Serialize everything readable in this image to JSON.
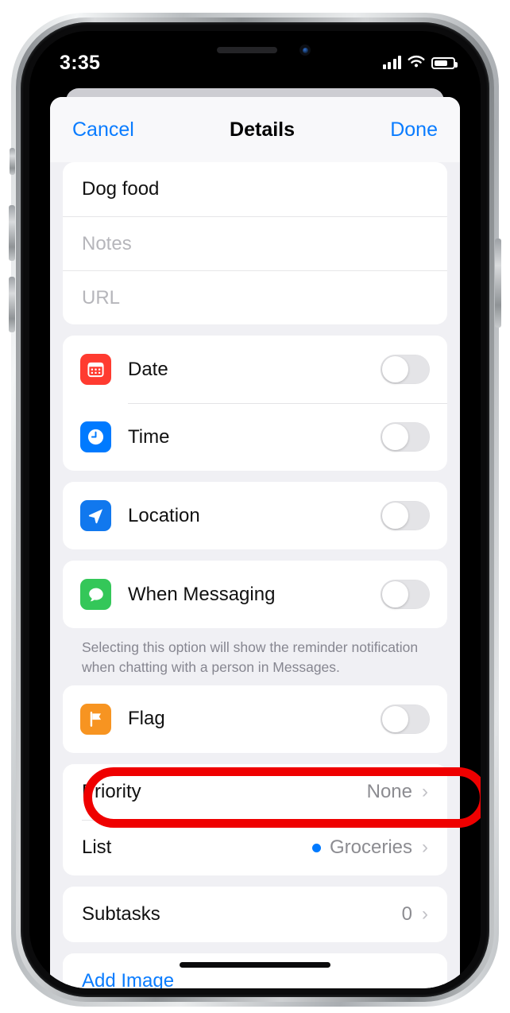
{
  "status_bar": {
    "time": "3:35",
    "signal_icon": "cellular-bars-icon",
    "wifi_icon": "wifi-icon",
    "battery_icon": "battery-icon"
  },
  "navbar": {
    "cancel_label": "Cancel",
    "title": "Details",
    "done_label": "Done"
  },
  "fields": {
    "title_value": "Dog food",
    "notes_placeholder": "Notes",
    "url_placeholder": "URL"
  },
  "toggle_rows": [
    {
      "label": "Date",
      "icon": "calendar-icon",
      "color": "#ff3b30",
      "on": false
    },
    {
      "label": "Time",
      "icon": "clock-icon",
      "color": "#007aff",
      "on": false
    },
    {
      "label": "Location",
      "icon": "location-arrow-icon",
      "color": "#007aff",
      "on": false
    },
    {
      "label": "When Messaging",
      "icon": "message-bubble-icon",
      "color": "#34c759",
      "on": false
    },
    {
      "label": "Flag",
      "icon": "flag-icon",
      "color": "#f79421",
      "on": false
    }
  ],
  "messaging_footnote": "Selecting this option will show the reminder notification when chatting with a person in Messages.",
  "value_rows": {
    "priority": {
      "label": "Priority",
      "value": "None",
      "chevron": "›"
    },
    "list": {
      "label": "List",
      "value": "Groceries",
      "dot_color": "#007aff",
      "chevron": "›"
    },
    "subtasks": {
      "label": "Subtasks",
      "value": "0",
      "chevron": "›"
    }
  },
  "add_image": {
    "label": "Add Image"
  },
  "annotation": {
    "shape": "red-ellipse-highlight",
    "target": "Priority",
    "color": "#ef0000"
  },
  "colors": {
    "accent_blue": "#0a7cff",
    "background": "#f0f0f4",
    "card": "#ffffff"
  }
}
